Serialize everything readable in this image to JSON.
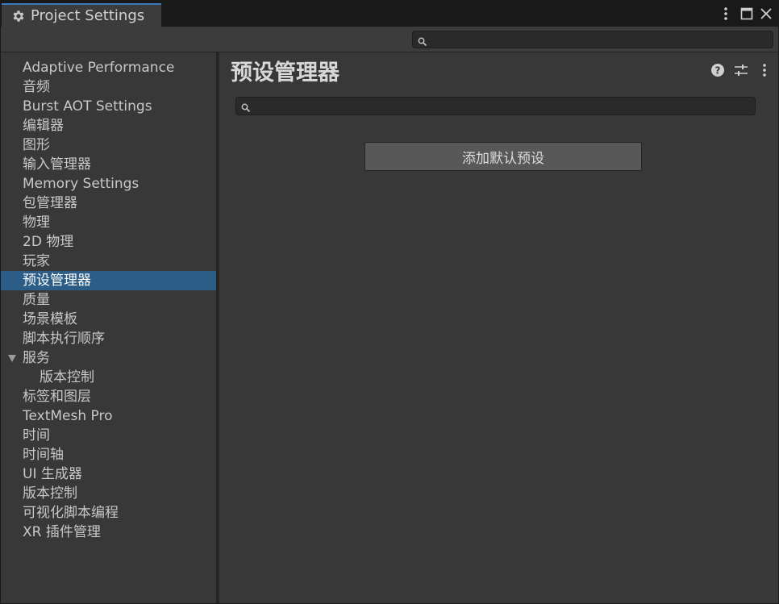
{
  "window": {
    "tab_title": "Project Settings",
    "tab_icon": "gear-icon"
  },
  "toolbar": {
    "search_value": ""
  },
  "sidebar": {
    "items": [
      {
        "label": "Adaptive Performance"
      },
      {
        "label": "音频"
      },
      {
        "label": "Burst AOT Settings"
      },
      {
        "label": "编辑器"
      },
      {
        "label": "图形"
      },
      {
        "label": "输入管理器"
      },
      {
        "label": "Memory Settings"
      },
      {
        "label": "包管理器"
      },
      {
        "label": "物理"
      },
      {
        "label": "2D 物理"
      },
      {
        "label": "玩家"
      },
      {
        "label": "预设管理器",
        "selected": true
      },
      {
        "label": "质量"
      },
      {
        "label": "场景模板"
      },
      {
        "label": "脚本执行顺序"
      },
      {
        "label": "服务",
        "expanded": true
      },
      {
        "label": "版本控制",
        "child": true
      },
      {
        "label": "标签和图层"
      },
      {
        "label": "TextMesh Pro"
      },
      {
        "label": "时间"
      },
      {
        "label": "时间轴"
      },
      {
        "label": "UI 生成器"
      },
      {
        "label": "版本控制"
      },
      {
        "label": "可视化脚本编程"
      },
      {
        "label": "XR 插件管理"
      }
    ]
  },
  "main": {
    "title": "预设管理器",
    "search_value": "",
    "add_default_label": "添加默认预设"
  },
  "colors": {
    "selected_bg": "#2c5d87",
    "tab_accent": "#3a79bb",
    "panel_bg": "#383838"
  }
}
